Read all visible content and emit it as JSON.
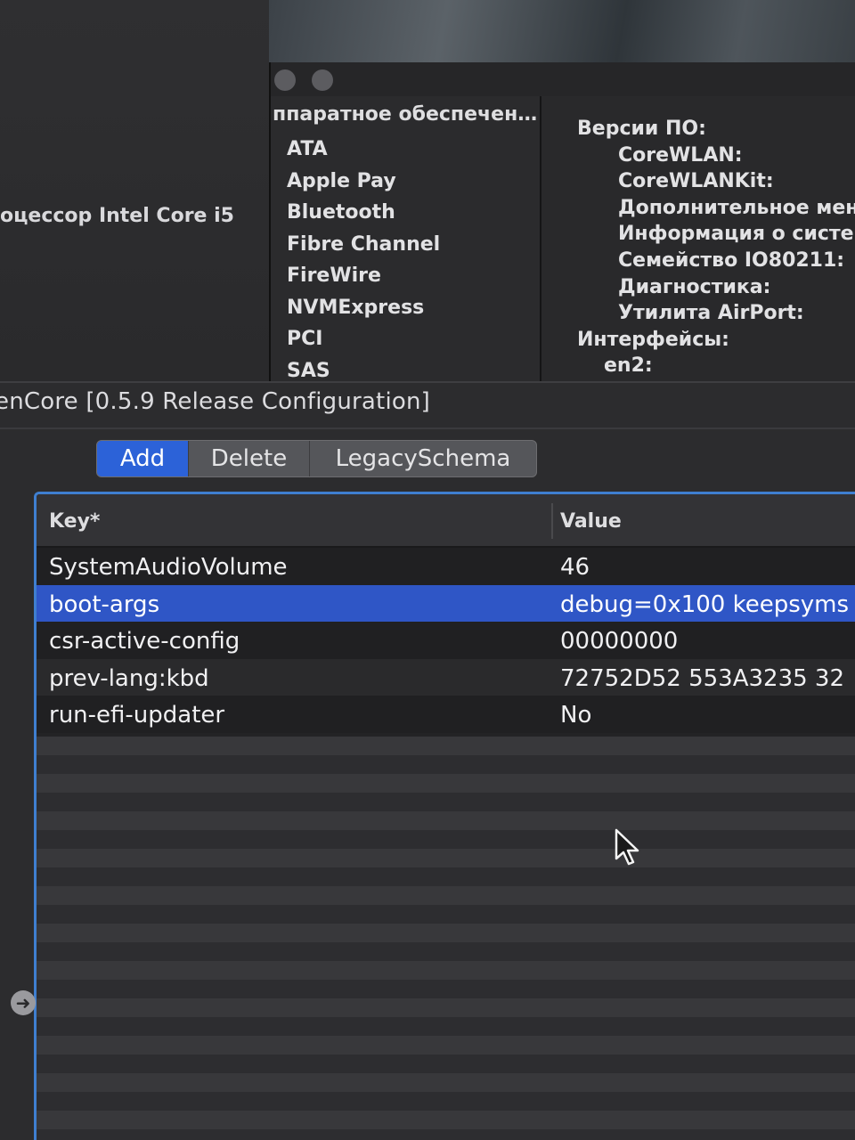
{
  "background_window": {
    "cpu_label": "оцессор Intel Core i5",
    "sidebar_header": "ппаратное обеспечен…",
    "sidebar_items": [
      "ATA",
      "Apple Pay",
      "Bluetooth",
      "Fibre Channel",
      "FireWire",
      "NVMExpress",
      "PCI",
      "SAS"
    ],
    "detail_items": [
      {
        "label": "Версии ПО:",
        "level": 0
      },
      {
        "label": "CoreWLAN:",
        "level": 1
      },
      {
        "label": "CoreWLANKit:",
        "level": 1
      },
      {
        "label": "Дополнительное мен",
        "level": 1
      },
      {
        "label": "Информация о систе",
        "level": 1
      },
      {
        "label": "Семейство IO80211:",
        "level": 1
      },
      {
        "label": "Диагностика:",
        "level": 1
      },
      {
        "label": "Утилита AirPort:",
        "level": 1
      },
      {
        "label": "Интерфейсы:",
        "level": 0
      },
      {
        "label": "en2:",
        "level": 2
      }
    ]
  },
  "oc_window": {
    "title": "enCore [0.5.9 Release Configuration]",
    "tabs": [
      {
        "label": "Add",
        "active": true
      },
      {
        "label": "Delete",
        "active": false
      },
      {
        "label": "LegacySchema",
        "active": false
      }
    ],
    "table": {
      "headers": {
        "key": "Key*",
        "value": "Value"
      },
      "rows": [
        {
          "key": "SystemAudioVolume",
          "value": "46",
          "selected": false
        },
        {
          "key": "boot-args",
          "value": "debug=0x100 keepsyms",
          "selected": true
        },
        {
          "key": "csr-active-config",
          "value": "00000000",
          "selected": false
        },
        {
          "key": "prev-lang:kbd",
          "value": "72752D52 553A3235 32",
          "selected": false
        },
        {
          "key": "run-efi-updater",
          "value": "No",
          "selected": false
        }
      ]
    },
    "side_arrow_glyph": "➜"
  },
  "colors": {
    "selection_blue": "#2f56c6",
    "tab_active_blue": "#2c62d8",
    "focus_ring": "#3f7fd0"
  }
}
